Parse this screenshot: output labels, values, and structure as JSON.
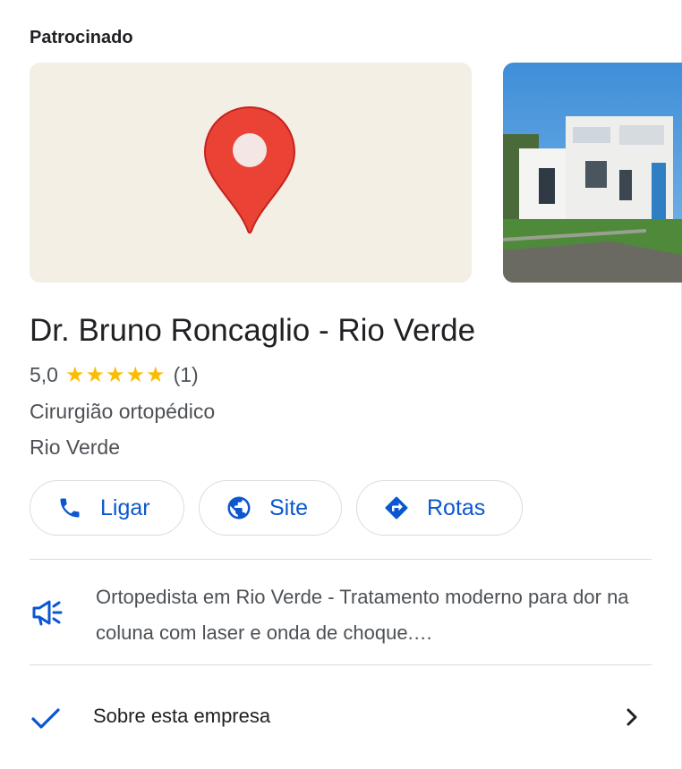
{
  "header": {
    "sponsored_label": "Patrocinado"
  },
  "business": {
    "name": "Dr. Bruno Roncaglio - Rio Verde",
    "rating_value": "5,0",
    "stars": "★★★★★",
    "rating_count": "(1)",
    "category": "Cirurgião ortopédico",
    "locality": "Rio Verde"
  },
  "media": {
    "map_icon": "map-pin-icon",
    "photo": "building-photo"
  },
  "actions": [
    {
      "label": "Ligar",
      "icon": "phone-icon"
    },
    {
      "label": "Site",
      "icon": "globe-icon"
    },
    {
      "label": "Rotas",
      "icon": "directions-icon"
    }
  ],
  "promo": {
    "icon": "megaphone-icon",
    "text": "Ortopedista em Rio Verde - Tratamento moderno para dor na coluna com laser e onda de choque.…"
  },
  "about": {
    "icon": "check-icon",
    "label": "Sobre esta empresa",
    "chevron": "chevron-right-icon"
  },
  "colors": {
    "accent": "#0b57d0",
    "star": "#fbbc04",
    "pin": "#ea4335",
    "map_bg": "#f3efe5",
    "secondary_text": "#4d5156"
  }
}
